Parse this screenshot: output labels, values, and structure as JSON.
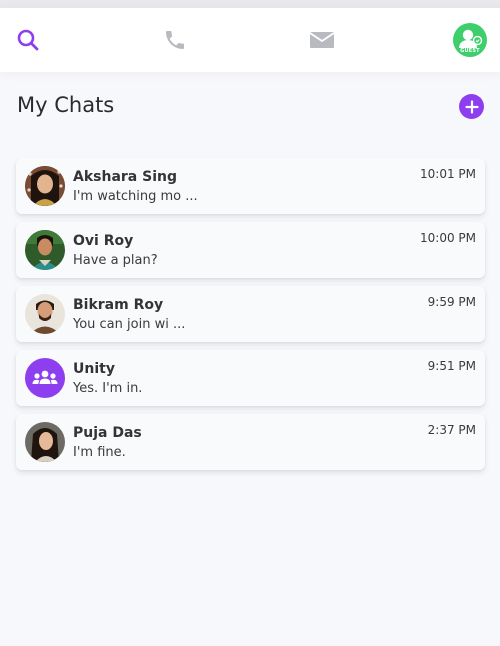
{
  "nav": {
    "icons": [
      "search-icon",
      "phone-icon",
      "mail-icon",
      "guest-avatar-icon"
    ],
    "guest_badge": "GUEST",
    "accent": "#8d3ff0",
    "muted": "#b9b9c0",
    "avatar_color": "#3ecf6c"
  },
  "header": {
    "title": "My Chats",
    "add_icon": "plus-icon"
  },
  "chats": [
    {
      "name": "Akshara Sing",
      "preview": "I'm watching mo ...",
      "time": "10:01 PM"
    },
    {
      "name": "Ovi Roy",
      "preview": "Have a plan?",
      "time": "10:00 PM"
    },
    {
      "name": "Bikram Roy",
      "preview": "You can join wi ...",
      "time": "9:59 PM"
    },
    {
      "name": "Unity",
      "preview": "Yes. I'm in.",
      "time": "9:51 PM"
    },
    {
      "name": "Puja Das",
      "preview": "I'm fine.",
      "time": "2:37 PM"
    }
  ]
}
